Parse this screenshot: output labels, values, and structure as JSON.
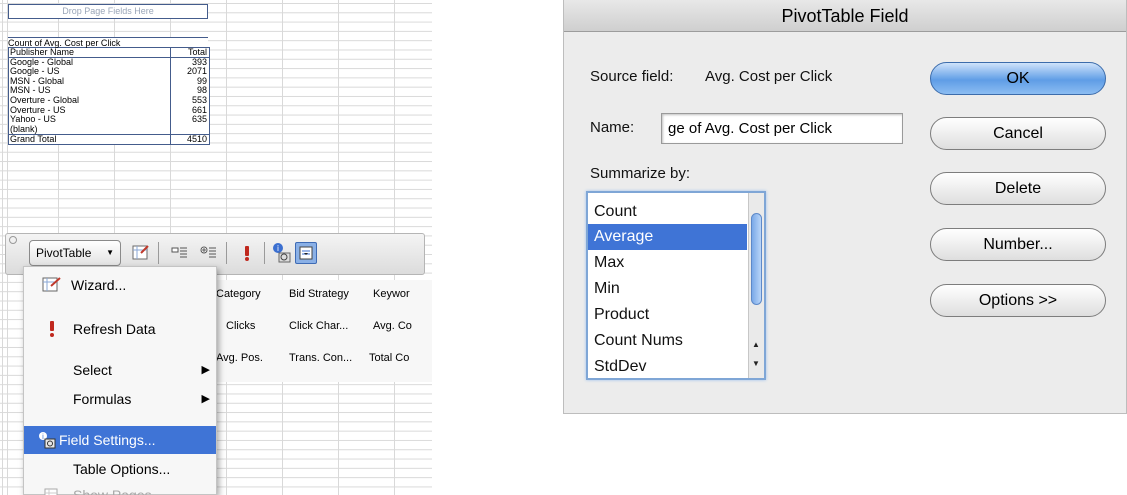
{
  "spreadsheet": {
    "drop_page_fields": "Drop Page Fields Here",
    "data_field": "Count of Avg. Cost per Click",
    "header": {
      "col1": "Publisher Name",
      "col2": "Total"
    },
    "rows": [
      {
        "name": "Google - Global",
        "value": "393"
      },
      {
        "name": "Google - US",
        "value": "2071"
      },
      {
        "name": "MSN - Global",
        "value": "99"
      },
      {
        "name": "MSN - US",
        "value": "98"
      },
      {
        "name": "Overture - Global",
        "value": "553"
      },
      {
        "name": "Overture - US",
        "value": "661"
      },
      {
        "name": "Yahoo - US",
        "value": "635"
      },
      {
        "name": "(blank)",
        "value": ""
      }
    ],
    "grand_total": {
      "name": "Grand Total",
      "value": "4510"
    }
  },
  "toolbar": {
    "pivottable_label": "PivotTable",
    "fields": {
      "category": "Category",
      "bid_strategy": "Bid Strategy",
      "keyword": "Keywor",
      "clicks": "Clicks",
      "click_char": "Click Char...",
      "avg_co": "Avg. Co",
      "avg_pos": "Avg. Pos.",
      "trans_con": "Trans. Con...",
      "total_co": "Total Co"
    }
  },
  "menu": {
    "items": [
      {
        "label": "Wizard...",
        "icon": "wizard-icon"
      },
      {
        "label": "Refresh Data",
        "icon": "exclamation-icon"
      },
      {
        "label": "Select",
        "submenu": true
      },
      {
        "label": "Formulas",
        "submenu": true
      },
      {
        "label": "Field Settings...",
        "icon": "field-settings-icon",
        "selected": true
      },
      {
        "label": "Table Options..."
      },
      {
        "label": "Show Pages...",
        "icon": "show-pages-icon",
        "disabled": true
      }
    ]
  },
  "dialog": {
    "title": "PivotTable Field",
    "source_label": "Source field:",
    "source_value": "Avg. Cost per Click",
    "name_label": "Name:",
    "name_value": "ge of Avg. Cost per Click",
    "summarize_label": "Summarize by:",
    "summarize_options": [
      "Count",
      "Average",
      "Max",
      "Min",
      "Product",
      "Count Nums",
      "StdDev"
    ],
    "selected_option": "Average",
    "buttons": {
      "ok": "OK",
      "cancel": "Cancel",
      "delete": "Delete",
      "number": "Number...",
      "options": "Options >>"
    }
  },
  "colors": {
    "selection": "#3f74d6",
    "default_button": "#5f9de6",
    "pivot_border": "#445c8c"
  }
}
